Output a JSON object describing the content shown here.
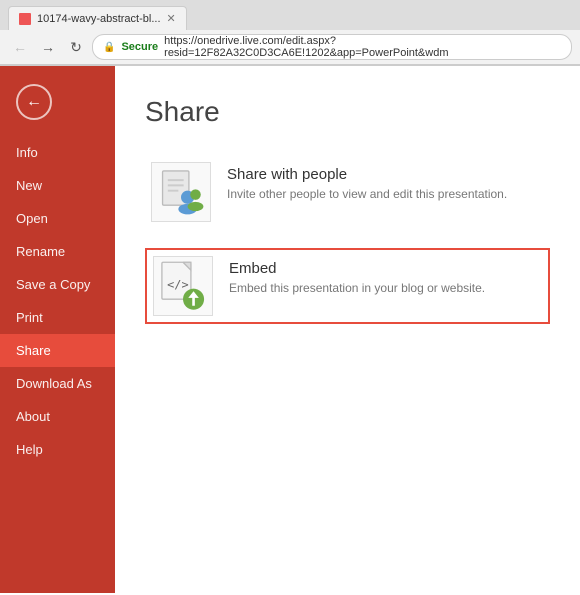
{
  "browser": {
    "tab_title": "10174-wavy-abstract-bl...",
    "address": "https://onedrive.live.com/edit.aspx?resid=12F82A32C0D3CA6E!1202&app=PowerPoint&wdm",
    "secure_label": "Secure"
  },
  "sidebar": {
    "back_arrow": "←",
    "items": [
      {
        "id": "info",
        "label": "Info",
        "active": false
      },
      {
        "id": "new",
        "label": "New",
        "active": false
      },
      {
        "id": "open",
        "label": "Open",
        "active": false
      },
      {
        "id": "rename",
        "label": "Rename",
        "active": false
      },
      {
        "id": "save-a-copy",
        "label": "Save a Copy",
        "active": false
      },
      {
        "id": "print",
        "label": "Print",
        "active": false
      },
      {
        "id": "share",
        "label": "Share",
        "active": true
      },
      {
        "id": "download-as",
        "label": "Download As",
        "active": false
      },
      {
        "id": "about",
        "label": "About",
        "active": false
      },
      {
        "id": "help",
        "label": "Help",
        "active": false
      }
    ]
  },
  "main": {
    "title": "Share",
    "options": [
      {
        "id": "share-with-people",
        "title": "Share with people",
        "description": "Invite other people to view and edit this presentation.",
        "highlighted": false
      },
      {
        "id": "embed",
        "title": "Embed",
        "description": "Embed this presentation in your blog or website.",
        "highlighted": true
      }
    ]
  }
}
